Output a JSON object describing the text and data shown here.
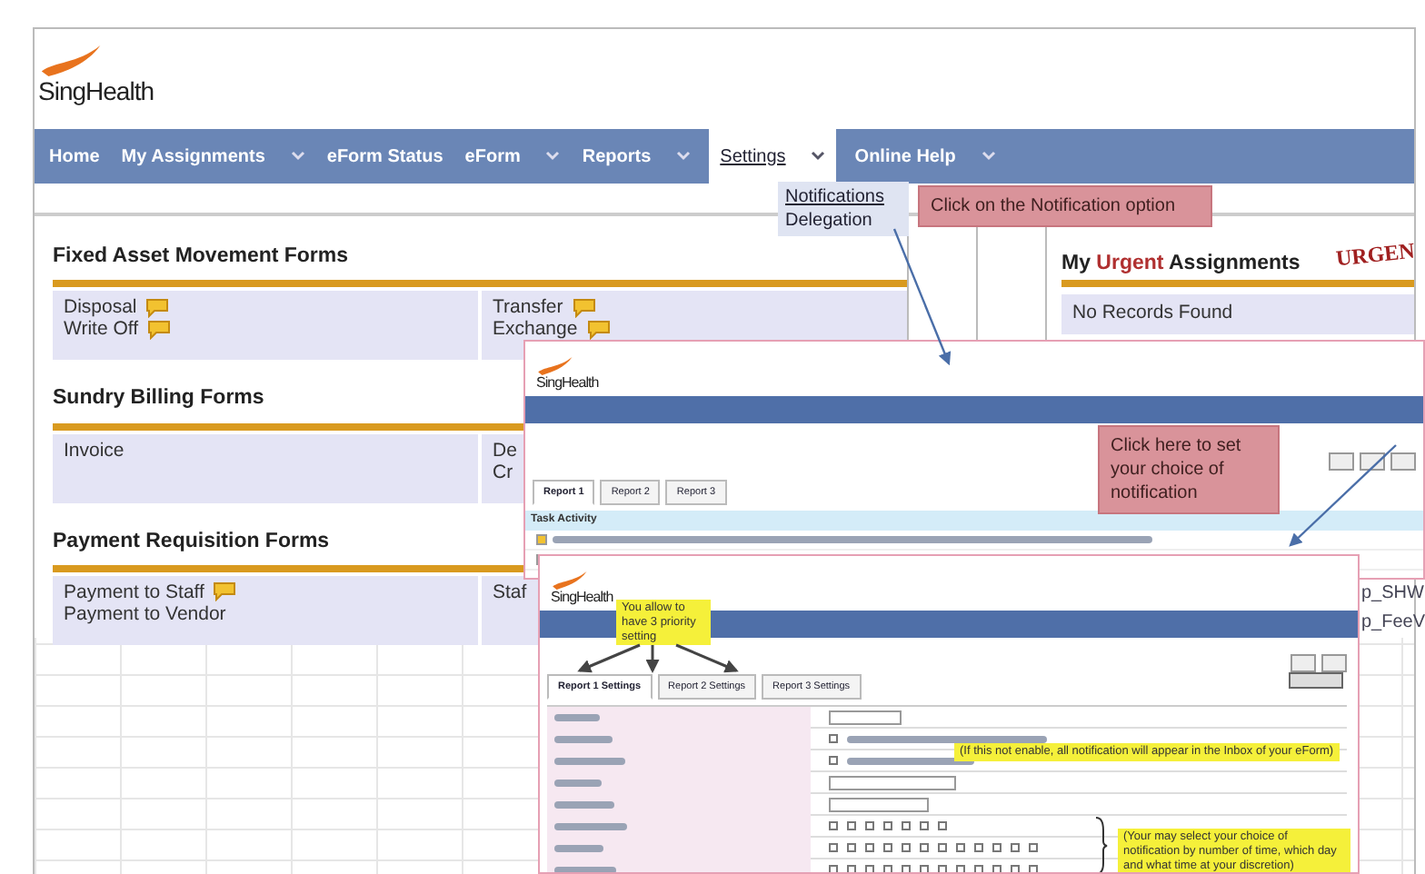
{
  "header": {
    "logo_text": "SingHealth"
  },
  "nav": [
    {
      "label": "Home",
      "has_menu": false,
      "selected": false
    },
    {
      "label": "My Assignments",
      "has_menu": true,
      "selected": false
    },
    {
      "label": "eForm Status",
      "has_menu": false,
      "selected": false
    },
    {
      "label": "eForm",
      "has_menu": true,
      "selected": false
    },
    {
      "label": "Reports",
      "has_menu": true,
      "selected": false
    },
    {
      "label": "Settings",
      "has_menu": true,
      "selected": true
    },
    {
      "label": "Online Help",
      "has_menu": true,
      "selected": false
    }
  ],
  "settings_menu": [
    {
      "label": "Notifications"
    },
    {
      "label": "Delegation"
    }
  ],
  "menu_callout": "Click on the Notification option",
  "form_sections": [
    {
      "title": "Fixed Asset Movement Forms",
      "columns": [
        [
          {
            "label": "Disposal",
            "note": true
          },
          {
            "label": "Write Off",
            "note": true
          }
        ],
        [
          {
            "label": "Transfer",
            "note": true
          },
          {
            "label": "Exchange",
            "note": true
          }
        ]
      ]
    },
    {
      "title": "Sundry Billing Forms",
      "columns": [
        [
          {
            "label": "Invoice",
            "note": false
          }
        ],
        [
          {
            "label": "De",
            "note": false
          },
          {
            "label": "Cr",
            "note": false
          }
        ]
      ]
    },
    {
      "title": "Payment Requisition Forms",
      "columns": [
        [
          {
            "label": "Payment to Staff",
            "note": true
          },
          {
            "label": "Payment to Vendor",
            "note": false
          }
        ],
        [
          {
            "label": "Staf",
            "note": false
          }
        ]
      ]
    }
  ],
  "urgent": {
    "title_parts": [
      {
        "text": "My",
        "highlight": false
      },
      {
        "text": "Urgent",
        "highlight": true
      },
      {
        "text": "Assignments",
        "highlight": false
      }
    ],
    "stamp": "URGEN",
    "message": "No Records Found",
    "side_texts": [
      "p_SHW",
      "p_FeeV"
    ]
  },
  "screenshot_1": {
    "logo_text": "SingHealth",
    "callout": "Click here to set your choice of notification",
    "tabs": [
      {
        "label": "Report 1",
        "selected": true
      },
      {
        "label": "Report 2",
        "selected": false
      },
      {
        "label": "Report 3",
        "selected": false
      }
    ],
    "section": "Task Activity"
  },
  "screenshot_2": {
    "logo_text": "SingHealth",
    "priority_note": "You allow to have 3 priority setting",
    "tabs": [
      {
        "label": "Report 1 Settings",
        "selected": true
      },
      {
        "label": "Report 2 Settings",
        "selected": false
      },
      {
        "label": "Report 3 Settings",
        "selected": false
      }
    ],
    "delivery_note": "(If this not enable, all notification will appear in the Inbox of your eForm)",
    "schedule_note": "(Your may select your choice of notification by number of time, which day and what time at your discretion)"
  }
}
